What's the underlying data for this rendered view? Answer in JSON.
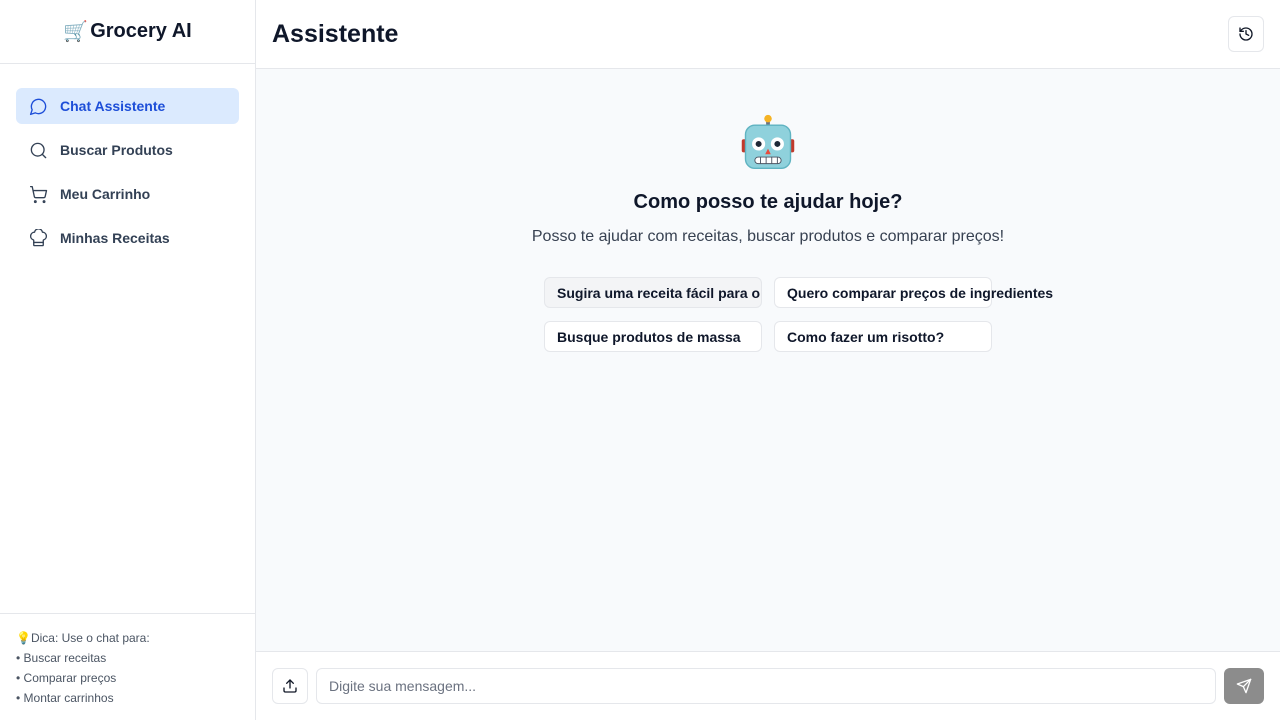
{
  "sidebar": {
    "brand": {
      "emoji": "🛒",
      "title": "Grocery AI"
    },
    "items": [
      {
        "label": "Chat Assistente",
        "icon": "chat-bubble-icon",
        "active": true
      },
      {
        "label": "Buscar Produtos",
        "icon": "search-icon",
        "active": false
      },
      {
        "label": "Meu Carrinho",
        "icon": "shopping-cart-icon",
        "active": false
      },
      {
        "label": "Minhas Receitas",
        "icon": "chef-hat-icon",
        "active": false
      }
    ],
    "tip": {
      "heading": "💡Dica: Use o chat para:",
      "lines": [
        "• Buscar receitas",
        "• Comparar preços",
        "• Montar carrinhos"
      ]
    }
  },
  "header": {
    "title": "Assistente",
    "history_icon": "history-icon"
  },
  "welcome": {
    "icon": "robot-icon",
    "title": "Como posso te ajudar hoje?",
    "subtitle": "Posso te ajudar com receitas, buscar produtos e comparar preços!"
  },
  "suggestions": [
    "Sugira uma receita fácil para o jantar",
    "Quero comparar preços de ingredientes",
    "Busque produtos de massa",
    "Como fazer um risotto?"
  ],
  "composer": {
    "upload_icon": "upload-icon",
    "placeholder": "Digite sua mensagem...",
    "send_icon": "send-icon"
  },
  "colors": {
    "accent": "#1d4ed8",
    "active_bg": "#dbeafe",
    "send_button": "#8c8c8c",
    "main_bg": "#f8fafc"
  }
}
